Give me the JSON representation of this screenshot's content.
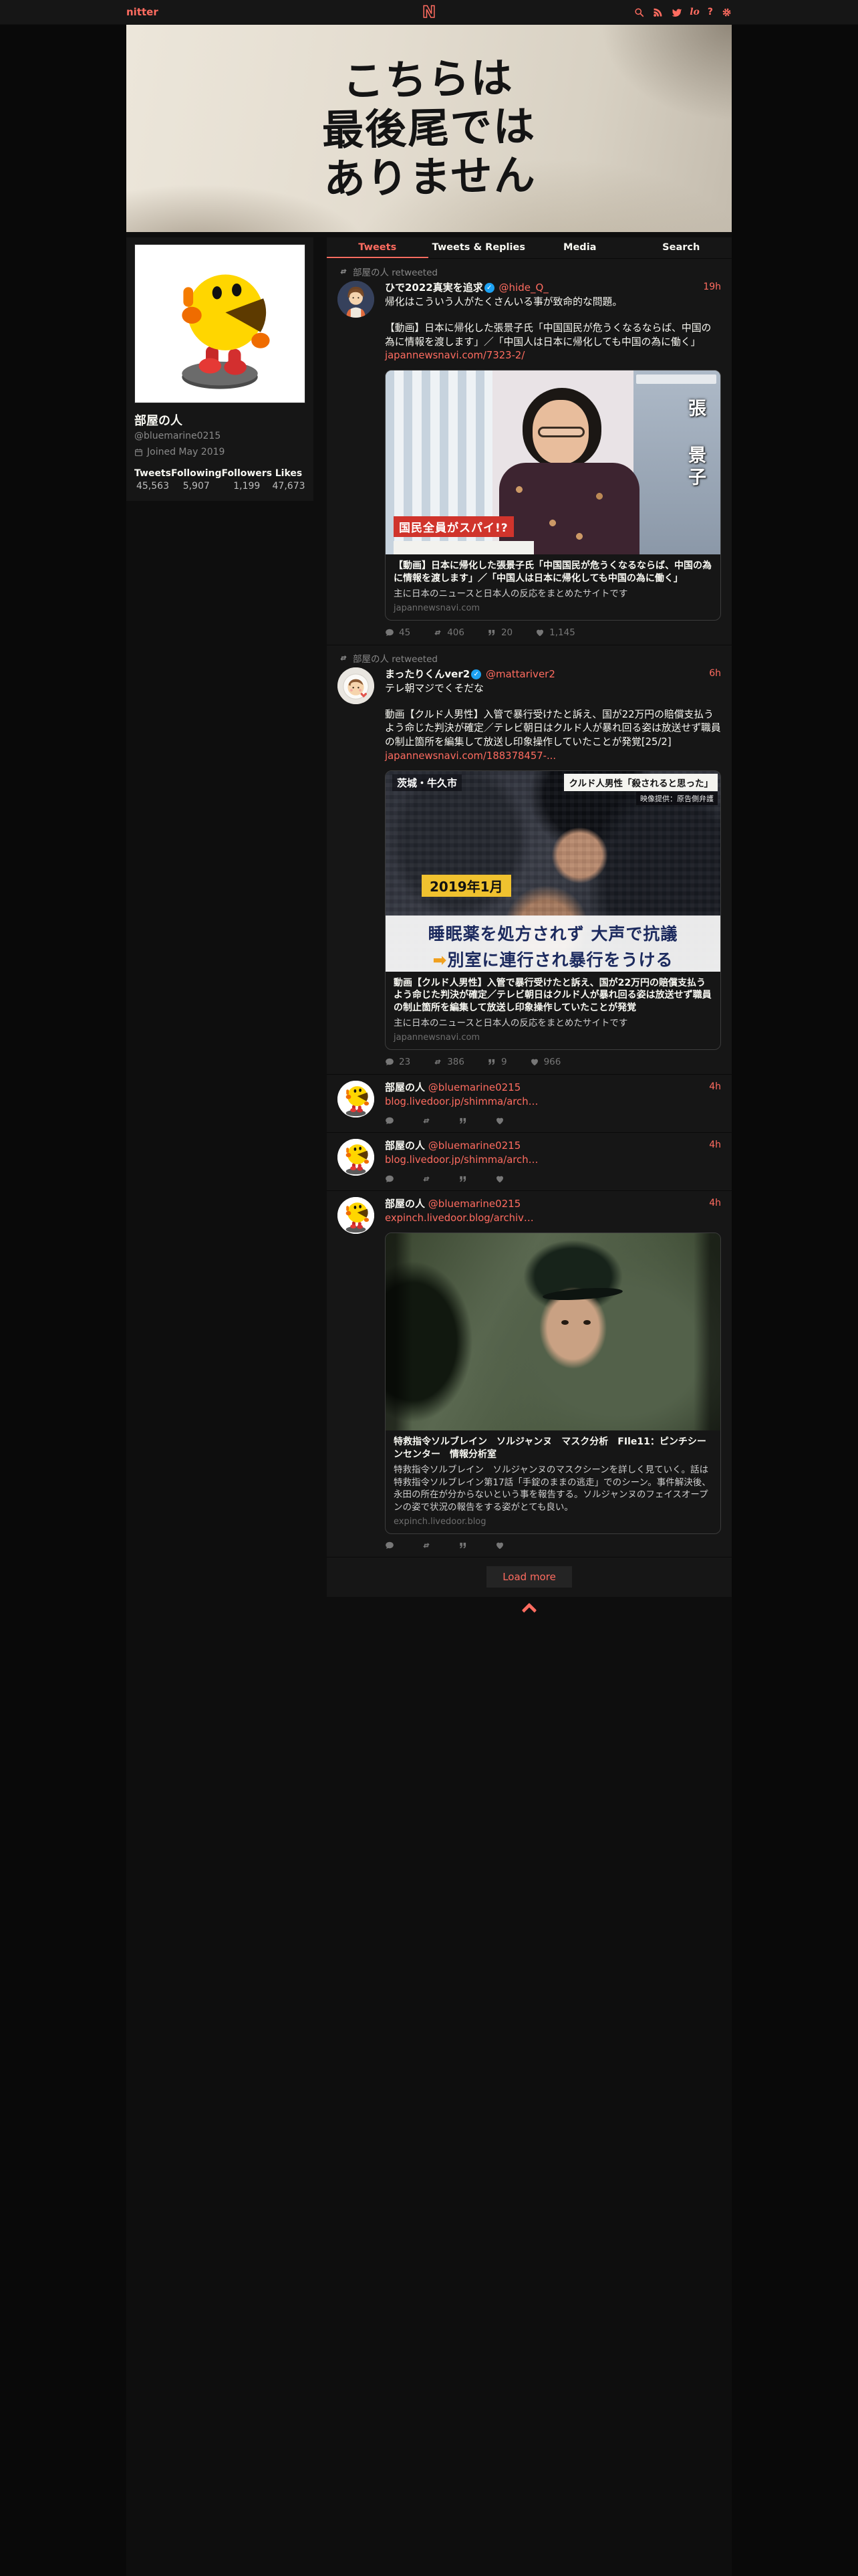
{
  "theme": {
    "accent": "#ff6c60",
    "verified_blue": "#1da1f2",
    "page_bg": "#090909",
    "panel_bg": "#161616"
  },
  "navbar": {
    "brand": "nitter",
    "logo": "N",
    "liberapay_glyph": "lo",
    "about_glyph": "?"
  },
  "banner": {
    "line1": "こちらは",
    "line2": "最後尾では",
    "line3": "ありません"
  },
  "profile": {
    "name": "部屋の人",
    "username": "@bluemarine0215",
    "joined": "Joined May 2019",
    "stats": {
      "tweets_label": "Tweets",
      "tweets": "45,563",
      "following_label": "Following",
      "following": "5,907",
      "followers_label": "Followers",
      "followers": "1,199",
      "likes_label": "Likes",
      "likes": "47,673"
    }
  },
  "tabs": {
    "tweets": "Tweets",
    "replies": "Tweets & Replies",
    "media": "Media",
    "search": "Search"
  },
  "tweets": [
    {
      "retweeted_by": "部屋の人 retweeted",
      "name": "ひで2022真実を追求",
      "verified": "✓",
      "handle": "@hide_Q_",
      "time": "19h",
      "text1": "帰化はこういう人がたくさんいる事が致命的な問題。",
      "text2": "【動画】日本に帰化した張景子氏「中国国民が危うくなるならば、中国の為に情報を渡します」／「中国人は日本に帰化しても中国の為に働く」",
      "link": "japannewsnavi.com/7323-2/",
      "overlays": {
        "red_banner": "国民全員がスパイ!?",
        "person_name": "張 景子"
      },
      "card": {
        "title": "【動画】日本に帰化した張景子氏「中国国民が危うくなるならば、中国の為に情報を渡します」／「中国人は日本に帰化しても中国の為に働く」",
        "desc": "主に日本のニュースと日本人の反応をまとめたサイトです",
        "dest": "japannewsnavi.com"
      },
      "stats": {
        "comments": "45",
        "retweets": "406",
        "quotes": "20",
        "likes": "1,145"
      }
    },
    {
      "retweeted_by": "部屋の人 retweeted",
      "name": "まったりくんver2",
      "verified": "✓",
      "handle": "@mattariver2",
      "time": "6h",
      "text1": "テレ朝マジでくそだな",
      "text2": "動画【クルド人男性】入管で暴行受けたと訴え、国が22万円の賠償支払うよう命じた判決が確定／テレビ朝日はクルド人が暴れ回る姿は放送せず職員の制止箇所を編集して放送し印象操作していたことが発覚[25/2]",
      "link": "japannewsnavi.com/188378457-...",
      "overlays": {
        "location": "茨城・牛久市",
        "quote_box": "クルド人男性「殺されると思った」",
        "credit": "映像提供：原告側弁護",
        "date_box": "2019年1月",
        "caption1": "睡眠薬を処方されず 大声で抗議",
        "arrow": "➡",
        "caption2": "別室に連行され暴行をうける"
      },
      "card": {
        "title": "動画【クルド人男性】入管で暴行受けたと訴え、国が22万円の賠償支払うよう命じた判決が確定／テレビ朝日はクルド人が暴れ回る姿は放送せず職員の制止箇所を編集して放送し印象操作していたことが発覚",
        "desc": "主に日本のニュースと日本人の反応をまとめたサイトです",
        "dest": "japannewsnavi.com"
      },
      "stats": {
        "comments": "23",
        "retweets": "386",
        "quotes": "9",
        "likes": "966"
      }
    },
    {
      "name": "部屋の人",
      "handle": "@bluemarine0215",
      "time": "4h",
      "link": "blog.livedoor.jp/shimma/arch…",
      "stats": {
        "comments": "",
        "retweets": "",
        "quotes": "",
        "likes": ""
      }
    },
    {
      "name": "部屋の人",
      "handle": "@bluemarine0215",
      "time": "4h",
      "link": "blog.livedoor.jp/shimma/arch…",
      "stats": {
        "comments": "",
        "retweets": "",
        "quotes": "",
        "likes": ""
      }
    },
    {
      "name": "部屋の人",
      "handle": "@bluemarine0215",
      "time": "4h",
      "link": "expinch.livedoor.blog/archiv…",
      "card": {
        "title": "特救指令ソルブレイン　ソルジャンヌ　マスク分析　FIle11：ピンチシーンセンター　情報分析室",
        "desc": "特救指令ソルブレイン　ソルジャンヌのマスクシーンを詳しく見ていく。話は特救指令ソルブレイン第17話「手錠のままの逃走」でのシーン。事件解決後、永田の所在が分からないという事を報告する。ソルジャンヌのフェイスオープンの姿で状況の報告をする姿がとても良い。",
        "dest": "expinch.livedoor.blog"
      },
      "stats": {
        "comments": "",
        "retweets": "",
        "quotes": "",
        "likes": ""
      }
    }
  ],
  "footer": {
    "load_more": "Load more"
  }
}
